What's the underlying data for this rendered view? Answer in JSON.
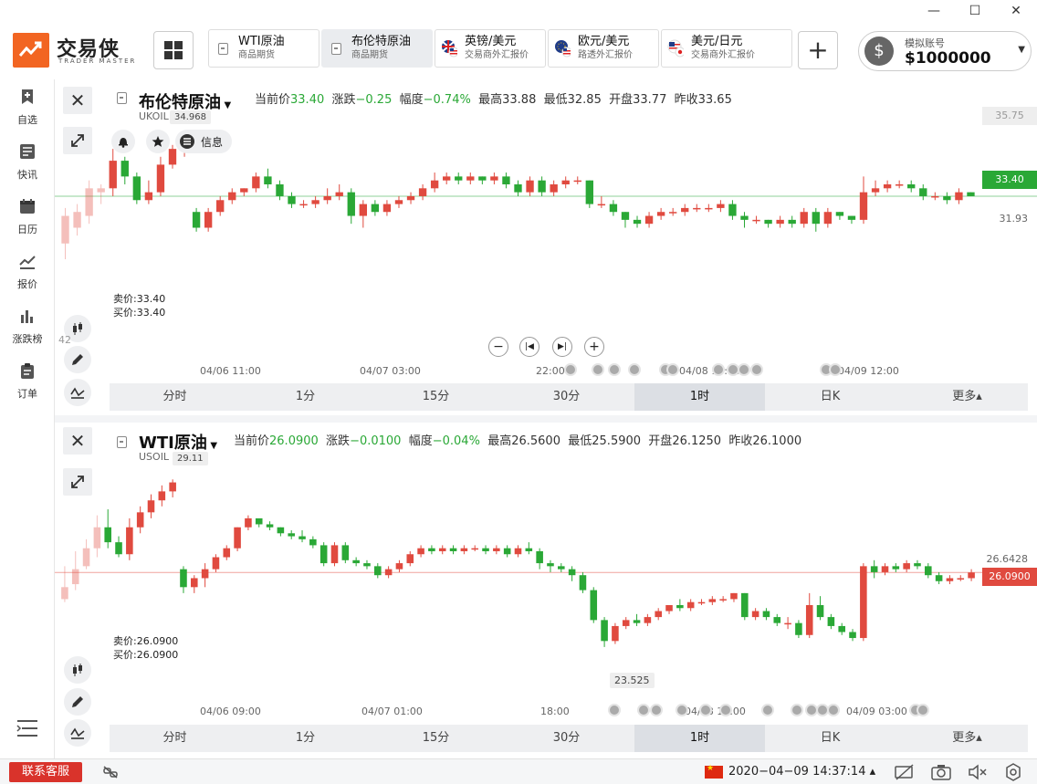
{
  "window": {
    "controls": [
      "minimize",
      "maximize",
      "close"
    ]
  },
  "brand": {
    "name": "交易侠",
    "sub": "TRADER MASTER"
  },
  "tabs": [
    {
      "name": "WTI原油",
      "sub": "商品期货",
      "active": false,
      "icon": "doc-icon"
    },
    {
      "name": "布伦特原油",
      "sub": "商品期货",
      "active": true,
      "icon": "doc-icon"
    },
    {
      "name": "英镑/美元",
      "sub": "交易商外汇报价",
      "active": false,
      "icon": "uk-us-flag-icon"
    },
    {
      "name": "欧元/美元",
      "sub": "路透外汇报价",
      "active": false,
      "icon": "eu-us-flag-icon"
    },
    {
      "name": "美元/日元",
      "sub": "交易商外汇报价",
      "active": false,
      "icon": "us-jp-flag-icon"
    }
  ],
  "account": {
    "label": "模拟账号",
    "balance": "$1000000"
  },
  "sidebar": [
    {
      "label": "自选",
      "icon": "bookmark-plus-icon"
    },
    {
      "label": "快讯",
      "icon": "news-icon"
    },
    {
      "label": "日历",
      "icon": "calendar-icon"
    },
    {
      "label": "报价",
      "icon": "chart-line-icon"
    },
    {
      "label": "涨跌榜",
      "icon": "bar-chart-icon"
    },
    {
      "label": "订单",
      "icon": "clipboard-icon"
    }
  ],
  "panels": [
    {
      "title": "布伦特原油",
      "code": "UKOIL",
      "hint": "34.968",
      "quote": {
        "cur_label": "当前价",
        "cur": "33.40",
        "chg_label": "涨跌",
        "chg": "−0.25",
        "amp_label": "幅度",
        "amp": "−0.74%",
        "high_label": "最高",
        "high": "33.88",
        "low_label": "最低",
        "low": "32.85",
        "open_label": "开盘",
        "open": "33.77",
        "prev_label": "昨收",
        "prev": "33.65"
      },
      "actions": {
        "info": "信息"
      },
      "bid": "卖价:33.40",
      "ask": "买价:33.40",
      "axis": {
        "top": "35.75",
        "current": "33.40",
        "low": "31.93",
        "left_partial": "42"
      },
      "times": [
        "04/06 11:00",
        "04/07 03:00",
        "22:00",
        "04/08 17:00",
        "04/09 12:00"
      ],
      "timeframes": [
        "分时",
        "1分",
        "15分",
        "30分",
        "1时",
        "日K",
        "更多▴"
      ],
      "active_tf": "1时"
    },
    {
      "title": "WTI原油",
      "code": "USOIL",
      "hint": "29.11",
      "quote": {
        "cur_label": "当前价",
        "cur": "26.0900",
        "chg_label": "涨跌",
        "chg": "−0.0100",
        "amp_label": "幅度",
        "amp": "−0.04%",
        "high_label": "最高",
        "high": "26.5600",
        "low_label": "最低",
        "low": "25.5900",
        "open_label": "开盘",
        "open": "26.1250",
        "prev_label": "昨收",
        "prev": "26.1000"
      },
      "bid": "卖价:26.0900",
      "ask": "买价:26.0900",
      "axis": {
        "top": "26.6428",
        "current": "26.0900",
        "min_label": "23.525"
      },
      "times": [
        "04/06 09:00",
        "04/07 01:00",
        "18:00",
        "04/08 11:00",
        "04/09 03:00"
      ],
      "timeframes": [
        "分时",
        "1分",
        "15分",
        "30分",
        "1时",
        "日K",
        "更多▴"
      ],
      "active_tf": "1时"
    }
  ],
  "status": {
    "support": "联系客服",
    "datetime": "2020−04−09 14:37:14 ▴"
  },
  "colors": {
    "up": "#e04a3f",
    "down": "#2aa836",
    "accent": "#f26522"
  },
  "chart_data": [
    {
      "type": "candlestick",
      "series_name": "UKOIL",
      "ylim": [
        31.5,
        35.9
      ],
      "last": 33.4,
      "candles": [
        [
          32.2,
          32.9,
          31.8,
          33.1
        ],
        [
          32.6,
          33.0,
          32.4,
          33.2
        ],
        [
          32.9,
          33.6,
          32.7,
          33.8
        ],
        [
          33.5,
          33.6,
          33.2,
          33.7
        ],
        [
          33.6,
          34.3,
          33.4,
          34.6
        ],
        [
          34.3,
          33.9,
          33.7,
          34.4
        ],
        [
          33.9,
          33.3,
          33.2,
          34.0
        ],
        [
          33.3,
          33.5,
          33.2,
          33.8
        ],
        [
          33.5,
          34.2,
          33.4,
          34.4
        ],
        [
          34.2,
          34.6,
          34.1,
          34.7
        ],
        [
          34.6,
          34.7,
          34.4,
          34.9
        ],
        [
          33.0,
          32.6,
          32.5,
          33.1
        ],
        [
          32.6,
          33.0,
          32.5,
          33.1
        ],
        [
          33.0,
          33.3,
          32.9,
          33.4
        ],
        [
          33.3,
          33.5,
          33.2,
          33.6
        ],
        [
          33.5,
          33.6,
          33.4,
          33.6
        ],
        [
          33.6,
          33.9,
          33.5,
          34.0
        ],
        [
          33.9,
          33.7,
          33.6,
          34.1
        ],
        [
          33.7,
          33.4,
          33.3,
          33.8
        ],
        [
          33.4,
          33.2,
          33.1,
          33.5
        ],
        [
          33.2,
          33.2,
          33.1,
          33.3
        ],
        [
          33.2,
          33.3,
          33.1,
          33.4
        ],
        [
          33.3,
          33.4,
          33.2,
          33.6
        ],
        [
          33.4,
          33.5,
          33.3,
          33.7
        ],
        [
          33.5,
          32.9,
          32.7,
          33.6
        ],
        [
          32.9,
          33.2,
          32.6,
          33.3
        ],
        [
          33.2,
          33.0,
          32.9,
          33.3
        ],
        [
          33.0,
          33.2,
          32.9,
          33.3
        ],
        [
          33.2,
          33.3,
          33.1,
          33.4
        ],
        [
          33.3,
          33.4,
          33.2,
          33.5
        ],
        [
          33.4,
          33.6,
          33.3,
          33.7
        ],
        [
          33.6,
          33.8,
          33.5,
          34.0
        ],
        [
          33.8,
          33.9,
          33.7,
          34.0
        ],
        [
          33.9,
          33.8,
          33.7,
          34.0
        ],
        [
          33.8,
          33.9,
          33.7,
          34.0
        ],
        [
          33.9,
          33.8,
          33.7,
          33.9
        ],
        [
          33.8,
          33.9,
          33.7,
          34.0
        ],
        [
          33.9,
          33.7,
          33.6,
          34.0
        ],
        [
          33.7,
          33.5,
          33.4,
          33.8
        ],
        [
          33.5,
          33.8,
          33.4,
          33.9
        ],
        [
          33.8,
          33.5,
          33.4,
          33.9
        ],
        [
          33.5,
          33.7,
          33.4,
          33.8
        ],
        [
          33.7,
          33.8,
          33.6,
          33.9
        ],
        [
          33.8,
          33.8,
          33.7,
          33.9
        ],
        [
          33.8,
          33.2,
          33.1,
          33.8
        ],
        [
          33.2,
          33.2,
          33.1,
          33.4
        ],
        [
          33.2,
          33.0,
          32.9,
          33.3
        ],
        [
          33.0,
          32.8,
          32.6,
          33.0
        ],
        [
          32.8,
          32.7,
          32.6,
          32.9
        ],
        [
          32.7,
          32.9,
          32.6,
          33.0
        ],
        [
          32.9,
          33.0,
          32.8,
          33.1
        ],
        [
          33.0,
          33.0,
          32.9,
          33.1
        ],
        [
          33.0,
          33.1,
          32.9,
          33.2
        ],
        [
          33.1,
          33.1,
          33.0,
          33.2
        ],
        [
          33.1,
          33.1,
          33.0,
          33.2
        ],
        [
          33.1,
          33.2,
          33.0,
          33.3
        ],
        [
          33.2,
          32.9,
          32.8,
          33.3
        ],
        [
          32.9,
          32.8,
          32.6,
          33.0
        ],
        [
          32.8,
          32.8,
          32.7,
          32.9
        ],
        [
          32.8,
          32.7,
          32.6,
          32.8
        ],
        [
          32.7,
          32.8,
          32.6,
          32.9
        ],
        [
          32.8,
          32.7,
          32.6,
          32.9
        ],
        [
          32.7,
          33.0,
          32.6,
          33.1
        ],
        [
          33.0,
          32.7,
          32.5,
          33.1
        ],
        [
          32.7,
          33.0,
          32.6,
          33.1
        ],
        [
          33.0,
          32.9,
          32.8,
          33.0
        ],
        [
          32.9,
          32.8,
          32.7,
          32.9
        ],
        [
          32.8,
          33.5,
          32.7,
          33.9
        ],
        [
          33.5,
          33.6,
          33.4,
          33.8
        ],
        [
          33.6,
          33.7,
          33.5,
          33.8
        ],
        [
          33.7,
          33.7,
          33.6,
          33.8
        ],
        [
          33.7,
          33.6,
          33.5,
          33.8
        ],
        [
          33.6,
          33.4,
          33.3,
          33.7
        ],
        [
          33.4,
          33.4,
          33.3,
          33.5
        ],
        [
          33.4,
          33.3,
          33.2,
          33.5
        ],
        [
          33.3,
          33.5,
          33.2,
          33.6
        ],
        [
          33.5,
          33.4,
          33.4,
          33.5
        ]
      ]
    },
    {
      "type": "candlestick",
      "series_name": "USOIL",
      "ylim": [
        23.2,
        29.3
      ],
      "last": 26.09,
      "candles": [
        [
          25.2,
          25.6,
          25.1,
          26.3
        ],
        [
          25.7,
          26.2,
          25.5,
          26.8
        ],
        [
          26.3,
          26.9,
          26.2,
          27.2
        ],
        [
          26.9,
          27.6,
          26.6,
          28.0
        ],
        [
          27.6,
          27.1,
          26.9,
          28.2
        ],
        [
          27.1,
          26.7,
          26.6,
          27.3
        ],
        [
          26.7,
          27.6,
          26.5,
          27.9
        ],
        [
          27.6,
          28.1,
          27.4,
          28.3
        ],
        [
          28.1,
          28.5,
          27.9,
          28.7
        ],
        [
          28.5,
          28.8,
          28.3,
          29.0
        ],
        [
          28.8,
          29.1,
          28.6,
          29.2
        ],
        [
          26.2,
          25.6,
          25.4,
          26.3
        ],
        [
          25.6,
          25.9,
          25.4,
          26.0
        ],
        [
          25.9,
          26.2,
          25.6,
          26.4
        ],
        [
          26.2,
          26.6,
          26.1,
          26.7
        ],
        [
          26.6,
          26.9,
          26.5,
          27.0
        ],
        [
          26.9,
          27.6,
          26.8,
          27.6
        ],
        [
          27.6,
          27.9,
          27.5,
          28.0
        ],
        [
          27.9,
          27.7,
          27.6,
          27.8
        ],
        [
          27.7,
          27.6,
          27.5,
          27.8
        ],
        [
          27.6,
          27.4,
          27.3,
          27.6
        ],
        [
          27.4,
          27.3,
          27.2,
          27.5
        ],
        [
          27.3,
          27.2,
          27.1,
          27.5
        ],
        [
          27.2,
          27.0,
          26.9,
          27.3
        ],
        [
          27.0,
          26.4,
          26.3,
          27.1
        ],
        [
          26.4,
          27.0,
          26.3,
          27.1
        ],
        [
          27.0,
          26.5,
          26.4,
          27.1
        ],
        [
          26.5,
          26.4,
          26.3,
          26.6
        ],
        [
          26.4,
          26.3,
          26.2,
          26.5
        ],
        [
          26.3,
          26.0,
          25.9,
          26.4
        ],
        [
          26.0,
          26.2,
          25.9,
          26.3
        ],
        [
          26.2,
          26.4,
          26.1,
          26.5
        ],
        [
          26.4,
          26.7,
          26.3,
          26.8
        ],
        [
          26.7,
          26.9,
          26.6,
          27.0
        ],
        [
          26.9,
          26.8,
          26.7,
          27.0
        ],
        [
          26.8,
          26.9,
          26.7,
          27.0
        ],
        [
          26.9,
          26.8,
          26.7,
          27.0
        ],
        [
          26.8,
          26.9,
          26.7,
          27.0
        ],
        [
          26.9,
          26.9,
          26.8,
          27.0
        ],
        [
          26.9,
          26.8,
          26.7,
          27.0
        ],
        [
          26.8,
          26.9,
          26.7,
          27.0
        ],
        [
          26.9,
          26.7,
          26.6,
          27.0
        ],
        [
          26.7,
          26.9,
          26.6,
          27.0
        ],
        [
          26.9,
          26.8,
          26.7,
          27.1
        ],
        [
          26.8,
          26.4,
          26.2,
          26.9
        ],
        [
          26.4,
          26.3,
          26.1,
          26.5
        ],
        [
          26.3,
          26.2,
          26.1,
          26.4
        ],
        [
          26.2,
          26.0,
          25.8,
          26.3
        ],
        [
          26.0,
          25.5,
          25.4,
          26.1
        ],
        [
          25.5,
          24.5,
          24.4,
          25.6
        ],
        [
          24.5,
          23.8,
          23.6,
          24.6
        ],
        [
          23.8,
          24.3,
          23.7,
          24.4
        ],
        [
          24.3,
          24.5,
          24.2,
          24.6
        ],
        [
          24.5,
          24.4,
          24.3,
          24.7
        ],
        [
          24.4,
          24.6,
          24.3,
          24.7
        ],
        [
          24.6,
          24.8,
          24.5,
          24.9
        ],
        [
          24.8,
          25.0,
          24.7,
          25.0
        ],
        [
          25.0,
          24.9,
          24.8,
          25.2
        ],
        [
          24.9,
          25.1,
          24.8,
          25.2
        ],
        [
          25.1,
          25.1,
          25.0,
          25.2
        ],
        [
          25.1,
          25.2,
          25.0,
          25.3
        ],
        [
          25.2,
          25.2,
          25.1,
          25.3
        ],
        [
          25.2,
          25.4,
          25.1,
          25.4
        ],
        [
          25.4,
          24.6,
          24.5,
          25.4
        ],
        [
          24.6,
          24.8,
          24.5,
          24.9
        ],
        [
          24.8,
          24.6,
          24.5,
          24.9
        ],
        [
          24.6,
          24.4,
          24.3,
          24.7
        ],
        [
          24.4,
          24.4,
          24.2,
          24.6
        ],
        [
          24.4,
          24.0,
          23.9,
          24.5
        ],
        [
          24.0,
          25.0,
          23.9,
          25.4
        ],
        [
          25.0,
          24.6,
          24.5,
          25.3
        ],
        [
          24.6,
          24.3,
          24.2,
          24.7
        ],
        [
          24.3,
          24.1,
          24.0,
          24.4
        ],
        [
          24.1,
          23.9,
          23.8,
          24.2
        ],
        [
          23.9,
          26.3,
          23.8,
          26.4
        ],
        [
          26.3,
          26.1,
          25.9,
          26.5
        ],
        [
          26.1,
          26.3,
          26.0,
          26.4
        ],
        [
          26.3,
          26.2,
          26.1,
          26.4
        ],
        [
          26.2,
          26.4,
          26.1,
          26.5
        ],
        [
          26.4,
          26.3,
          26.2,
          26.5
        ],
        [
          26.3,
          26.0,
          25.9,
          26.4
        ],
        [
          26.0,
          25.8,
          25.7,
          26.1
        ],
        [
          25.8,
          25.9,
          25.7,
          26.0
        ],
        [
          25.9,
          25.9,
          25.8,
          26.0
        ],
        [
          25.9,
          26.09,
          25.8,
          26.2
        ]
      ]
    }
  ]
}
